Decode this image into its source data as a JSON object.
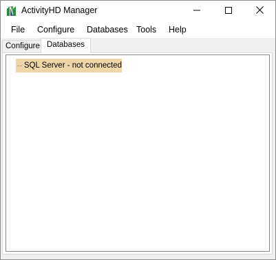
{
  "window": {
    "title": "ActivityHD Manager",
    "app_icon": "activityhd-logo-icon",
    "controls": {
      "minimize": "minimize-icon",
      "maximize": "maximize-icon",
      "close": "close-icon"
    }
  },
  "menu": {
    "items": [
      {
        "label": "File"
      },
      {
        "label": "Configure"
      },
      {
        "label": "Databases"
      },
      {
        "label": "Tools"
      },
      {
        "label": "Help"
      }
    ]
  },
  "tabs": [
    {
      "label": "Configure",
      "selected": false
    },
    {
      "label": "Databases",
      "selected": true
    }
  ],
  "tree": {
    "nodes": [
      {
        "label": "SQL Server - not connected",
        "selected": true
      }
    ]
  },
  "colors": {
    "selection": "#efd6a7",
    "window_border": "#8c8c8c",
    "logo_green": "#2e8b3a"
  }
}
